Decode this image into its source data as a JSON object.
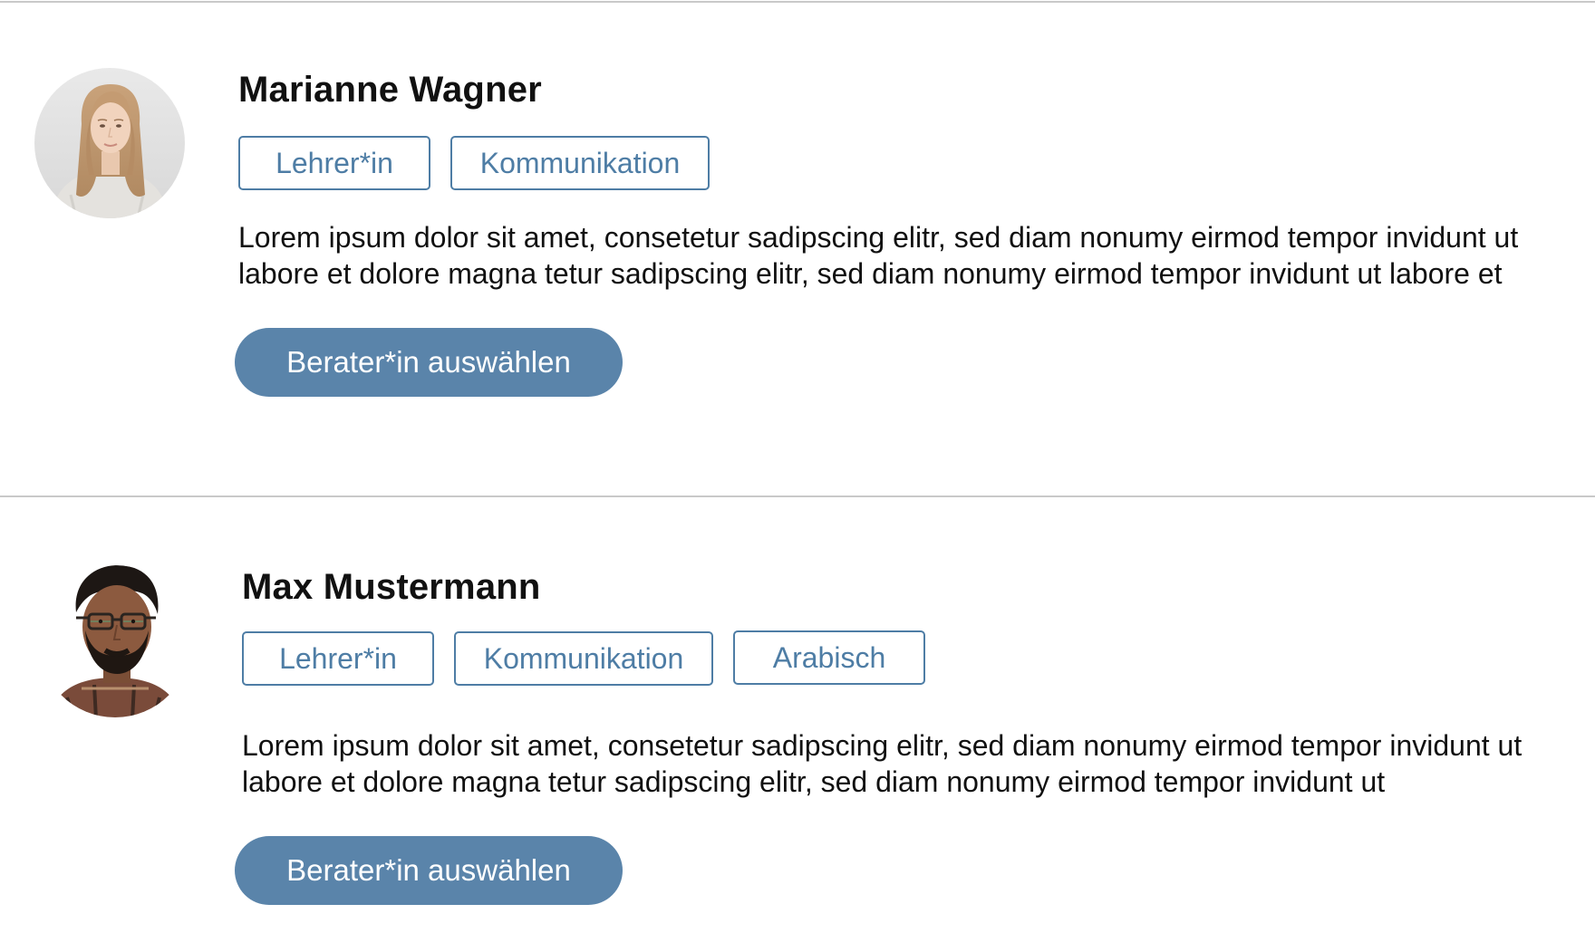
{
  "advisors": [
    {
      "name": "Marianne Wagner",
      "tags": [
        "Lehrer*in",
        "Kommunikation"
      ],
      "description": "Lorem ipsum dolor sit amet, consetetur sadipscing elitr, sed diam nonumy eirmod tempor invidunt ut labore et dolore magna tetur sadipscing elitr, sed diam nonumy eirmod tempor invidunt ut labore et",
      "button_label": "Berater*in auswählen"
    },
    {
      "name": "Max Mustermann",
      "tags": [
        "Lehrer*in",
        "Kommunikation",
        "Arabisch"
      ],
      "description": "Lorem ipsum dolor sit amet, consetetur sadipscing elitr, sed diam nonumy eirmod tempor invidunt ut labore et dolore magna tetur sadipscing elitr, sed diam nonumy eirmod tempor invidunt ut",
      "button_label": "Berater*in auswählen"
    }
  ],
  "colors": {
    "accent": "#5a84aa",
    "tag_border": "#4e7da5",
    "divider": "#c9c9c9",
    "text": "#111111"
  }
}
